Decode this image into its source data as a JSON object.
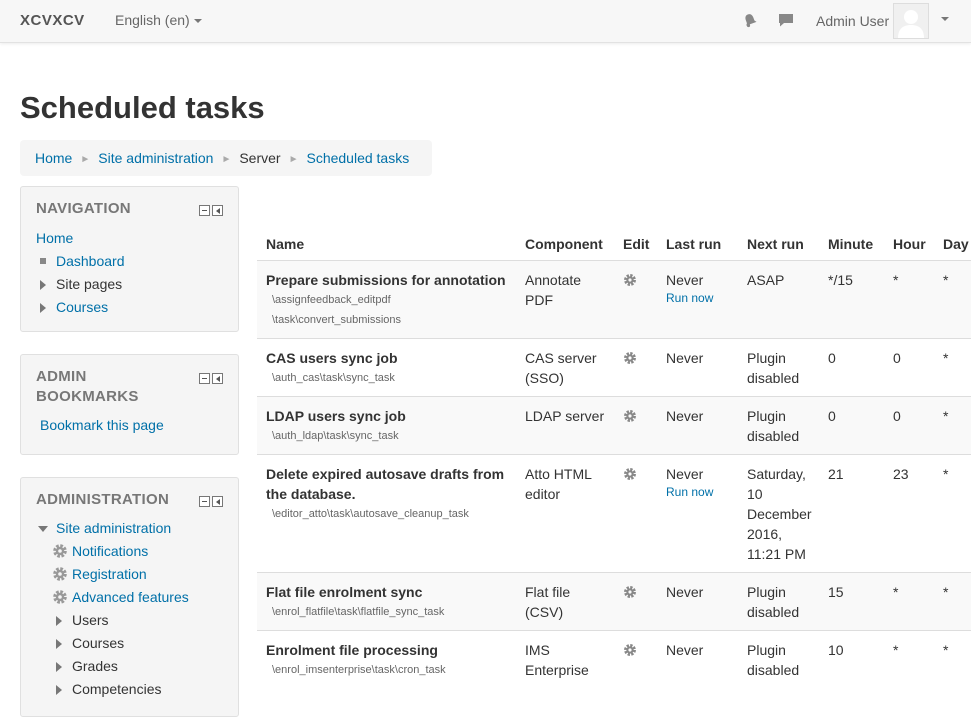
{
  "navbar": {
    "brand": "XCVXCV",
    "language": "English (en)",
    "user_name": "Admin User"
  },
  "page": {
    "title": "Scheduled tasks"
  },
  "breadcrumb": {
    "home": "Home",
    "site_admin": "Site administration",
    "server": "Server",
    "scheduled_tasks": "Scheduled tasks"
  },
  "navigation": {
    "title": "NAVIGATION",
    "home": "Home",
    "dashboard": "Dashboard",
    "site_pages": "Site pages",
    "courses": "Courses"
  },
  "admin_bookmarks": {
    "title_line1": "ADMIN",
    "title_line2": "BOOKMARKS",
    "bookmark_link": "Bookmark this page"
  },
  "administration": {
    "title": "ADMINISTRATION",
    "site_admin": "Site administration",
    "notifications": "Notifications",
    "registration": "Registration",
    "advanced_features": "Advanced features",
    "users": "Users",
    "courses": "Courses",
    "grades": "Grades",
    "competencies": "Competencies"
  },
  "table": {
    "headers": {
      "name": "Name",
      "component": "Component",
      "edit": "Edit",
      "last_run": "Last run",
      "next_run": "Next run",
      "minute": "Minute",
      "hour": "Hour",
      "day": "Day"
    },
    "run_now_label": "Run now",
    "rows": [
      {
        "name": "Prepare submissions for annotation",
        "class_line1": "\\assignfeedback_editpdf",
        "class_line2": "\\task\\convert_submissions",
        "component": "Annotate PDF",
        "last_run": "Never",
        "next_run": "ASAP",
        "minute": "*/15",
        "hour": "*",
        "day": "*"
      },
      {
        "name": "CAS users sync job",
        "class_line1": "\\auth_cas\\task\\sync_task",
        "component": "CAS server (SSO)",
        "last_run": "Never",
        "next_run": "Plugin disabled",
        "minute": "0",
        "hour": "0",
        "day": "*"
      },
      {
        "name": "LDAP users sync job",
        "class_line1": "\\auth_ldap\\task\\sync_task",
        "component": "LDAP server",
        "last_run": "Never",
        "next_run": "Plugin disabled",
        "minute": "0",
        "hour": "0",
        "day": "*"
      },
      {
        "name": "Delete expired autosave drafts from the database.",
        "class_line1": "\\editor_atto\\task\\autosave_cleanup_task",
        "component": "Atto HTML editor",
        "last_run": "Never",
        "next_run": "Saturday, 10 December 2016, 11:21 PM",
        "minute": "21",
        "hour": "23",
        "day": "*"
      },
      {
        "name": "Flat file enrolment sync",
        "class_line1": "\\enrol_flatfile\\task\\flatfile_sync_task",
        "component": "Flat file (CSV)",
        "last_run": "Never",
        "next_run": "Plugin disabled",
        "minute": "15",
        "hour": "*",
        "day": "*"
      },
      {
        "name": "Enrolment file processing",
        "class_line1": "\\enrol_imsenterprise\\task\\cron_task",
        "component": "IMS Enterprise",
        "last_run": "Never",
        "next_run": "Plugin disabled",
        "minute": "10",
        "hour": "*",
        "day": "*"
      }
    ]
  }
}
